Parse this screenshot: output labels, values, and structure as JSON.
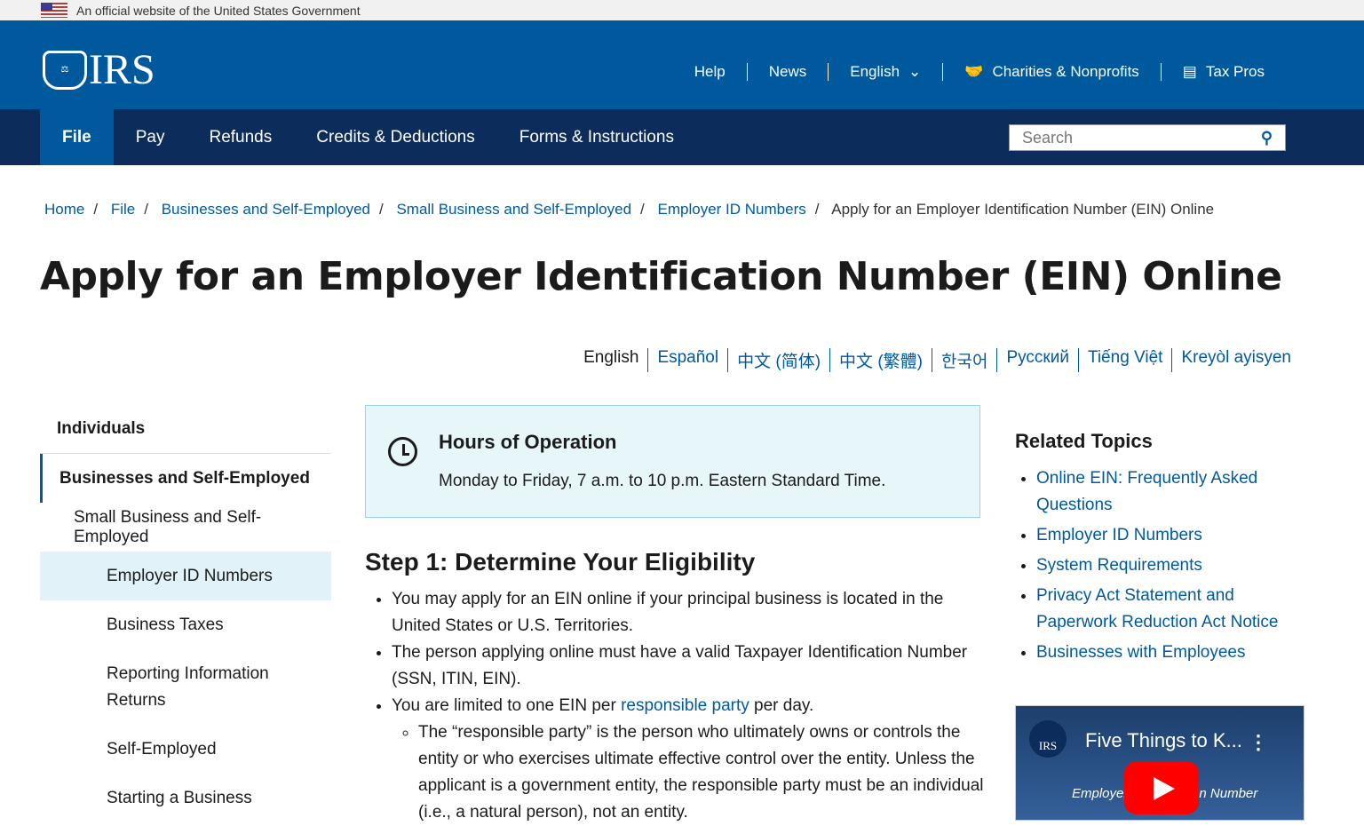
{
  "gov_banner": "An official website of the United States Government",
  "logo": "IRS",
  "utility": {
    "help": "Help",
    "news": "News",
    "language": "English",
    "charities": "Charities & Nonprofits",
    "taxpros": "Tax Pros"
  },
  "nav": [
    "File",
    "Pay",
    "Refunds",
    "Credits & Deductions",
    "Forms & Instructions"
  ],
  "search": {
    "placeholder": "Search"
  },
  "breadcrumb": [
    "Home",
    "File",
    "Businesses and Self-Employed",
    "Small Business and Self-Employed",
    "Employer ID Numbers"
  ],
  "breadcrumb_current": "Apply for an Employer Identification Number (EIN) Online",
  "title": "Apply for an Employer Identification Number (EIN) Online",
  "languages": [
    "English",
    "Español",
    "中文 (简体)",
    "中文 (繁體)",
    "한국어",
    "Русский",
    "Tiếng Việt",
    "Kreyòl ayisyen"
  ],
  "sidebar": [
    "Individuals",
    "Businesses and Self-Employed",
    "Small Business and Self-Employed",
    "Employer ID Numbers",
    "Business Taxes",
    "Reporting Information Returns",
    "Self-Employed",
    "Starting a Business"
  ],
  "hours": {
    "title": "Hours of Operation",
    "text": "Monday to Friday, 7 a.m. to 10 p.m. Eastern Standard Time."
  },
  "step1": {
    "title": "Step 1: Determine Your Eligibility",
    "b1": "You may apply for an EIN online if your principal business is located in the United States or U.S. Territories.",
    "b2": "The person applying online must have a valid Taxpayer Identification Number (SSN, ITIN, EIN).",
    "b3_pre": "You are limited to one EIN per ",
    "b3_link": "responsible party",
    "b3_post": " per day.",
    "sub": "The “responsible party” is the person who ultimately owns or controls the entity or who exercises ultimate effective control over the entity. Unless the applicant is a government entity, the responsible party must be an individual (i.e., a natural person), not an entity."
  },
  "related": {
    "title": "Related Topics",
    "links": [
      "Online EIN: Frequently Asked Questions",
      "Employer ID Numbers",
      "System Requirements",
      "Privacy Act Statement and Paperwork Reduction Act Notice",
      "Businesses with Employees"
    ]
  },
  "video": {
    "title": "Five Things to K...",
    "subtitle": "Employer Identification Number",
    "logo": "IRS"
  }
}
